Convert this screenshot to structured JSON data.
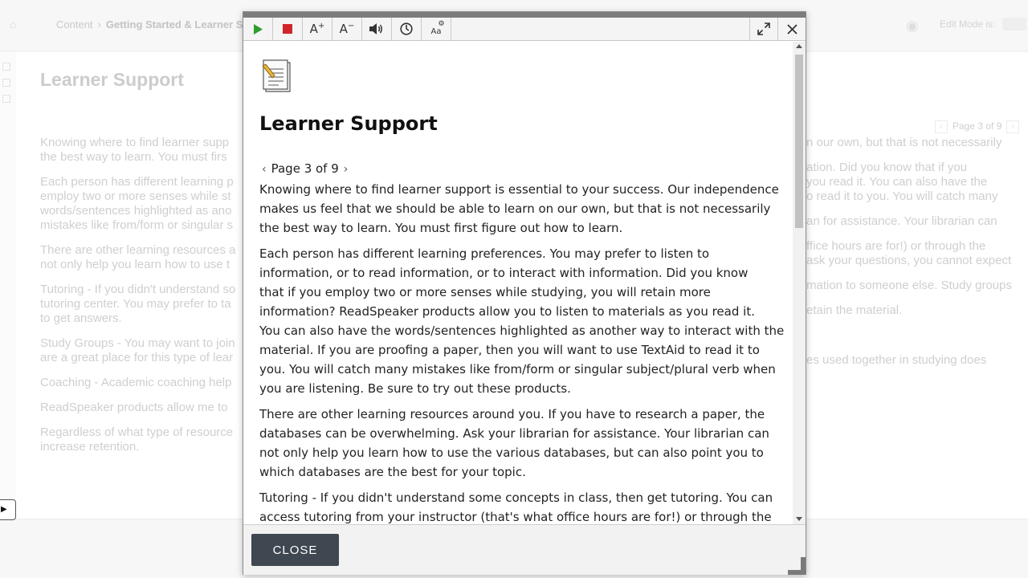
{
  "background": {
    "breadcrumb": {
      "home": "⌂",
      "root": "Content",
      "separator": "›",
      "current": "Getting Started & Learner Su"
    },
    "edit_mode_label": "Edit Mode is:",
    "page_title": "Learner Support",
    "pager_text": "Page 3 of 9",
    "left_column": [
      [
        "Knowing where to find learner supp",
        "the best way to learn.  You must firs"
      ],
      [
        "Each person has different learning p",
        "employ two or more senses while st",
        "words/sentences highlighted as ano",
        "mistakes like from/form or singular s"
      ],
      [
        "There are other learning resources a",
        "not only help you learn how to use t"
      ],
      [
        "Tutoring - If you didn't understand so",
        "tutoring center.  You may prefer to ta",
        "to get answers."
      ],
      [
        "Study Groups - You may want to join",
        "are a great place for this type of lear"
      ],
      [
        "Coaching - Academic coaching help"
      ],
      [
        "ReadSpeaker products allow me to"
      ],
      [
        "Regardless of what type of resource",
        "increase retention."
      ]
    ],
    "right_column": [
      [
        "n our own, but that is not necessarily",
        ""
      ],
      [
        "ation.  Did you know that if you",
        "you read it.  You can also have the",
        "o read it to you.  You will catch many",
        ""
      ],
      [
        "an for assistance.  Your librarian can",
        ""
      ],
      [
        "ffice hours are for!) or through the",
        "ask your questions, you cannot expect",
        ""
      ],
      [
        "mation to someone else. Study groups",
        ""
      ],
      [
        "etain the material."
      ],
      [
        ""
      ],
      [
        "es used together in studying does",
        ""
      ]
    ]
  },
  "dialog": {
    "toolbar": {
      "play": "Play",
      "stop": "Stop",
      "increase_text": "A+",
      "decrease_text": "A-",
      "volume": "Volume",
      "speed": "Speed",
      "text_settings": "Aa",
      "expand": "Expand",
      "close": "Close"
    },
    "title": "Learner Support",
    "pager": {
      "prev": "‹",
      "text": "Page 3 of 9",
      "next": "›"
    },
    "paragraphs": [
      [
        "Knowing where to find learner support is essential to your success. Our independence",
        "makes us feel that we should be able to learn on our own, but that is not necessarily",
        "the best way to learn.  You must first figure out how to learn."
      ],
      [
        "Each person has different learning preferences.  You may prefer to listen to",
        "information, or to read information, or to interact with information.  Did you know",
        "that if you employ two or more senses while studying, you will retain more",
        "information?  ReadSpeaker products allow you to listen to materials as you read it.",
        "You can also have the words/sentences highlighted as another way to interact with the",
        "material.  If you are proofing a paper, then you will want to use TextAid to read it to",
        "you.  You will catch many mistakes like from/form or singular subject/plural verb when",
        "you are listening.  Be sure to try out these products."
      ],
      [
        "There are other learning resources around you.   If you have to research a paper, the",
        "databases can be overwhelming.  Ask your librarian for assistance.  Your librarian can",
        "not only help you learn how to use the various databases, but can also point you to",
        "which databases are the best for your topic."
      ],
      [
        "Tutoring - If you didn't understand some concepts in class, then get tutoring.  You can",
        "access tutoring from your instructor (that's what office hours are for!) or through the"
      ]
    ],
    "close_button": "CLOSE"
  }
}
